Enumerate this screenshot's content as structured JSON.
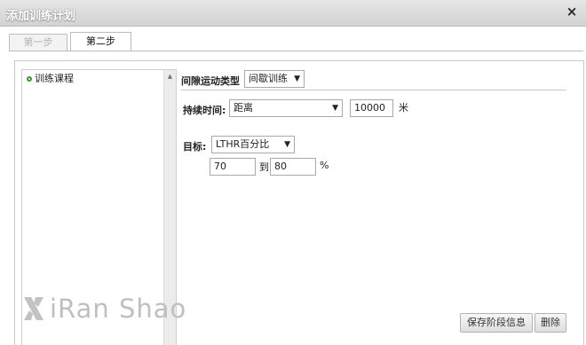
{
  "dialog": {
    "title": "添加训练计划",
    "close_icon": "×"
  },
  "tabs": [
    {
      "label": "第一步",
      "active": false
    },
    {
      "label": "第二步",
      "active": true
    }
  ],
  "list": {
    "items": [
      {
        "label": "训练课程"
      }
    ]
  },
  "form": {
    "interval_type": {
      "label": "间隙运动类型",
      "value": "间歇训练"
    },
    "duration": {
      "label": "持续时间:",
      "type_value": "距离",
      "amount": "10000",
      "unit": "米"
    },
    "target": {
      "label": "目标:",
      "type_value": "LTHR百分比",
      "from": "70",
      "to_label": "到",
      "to": "80",
      "unit": "%"
    }
  },
  "buttons": {
    "save_stage": "保存阶段信息",
    "delete": "删除"
  },
  "watermark": {
    "text": "iRan Shao"
  },
  "colors": {
    "accent_dot": "#3a9a2e"
  }
}
